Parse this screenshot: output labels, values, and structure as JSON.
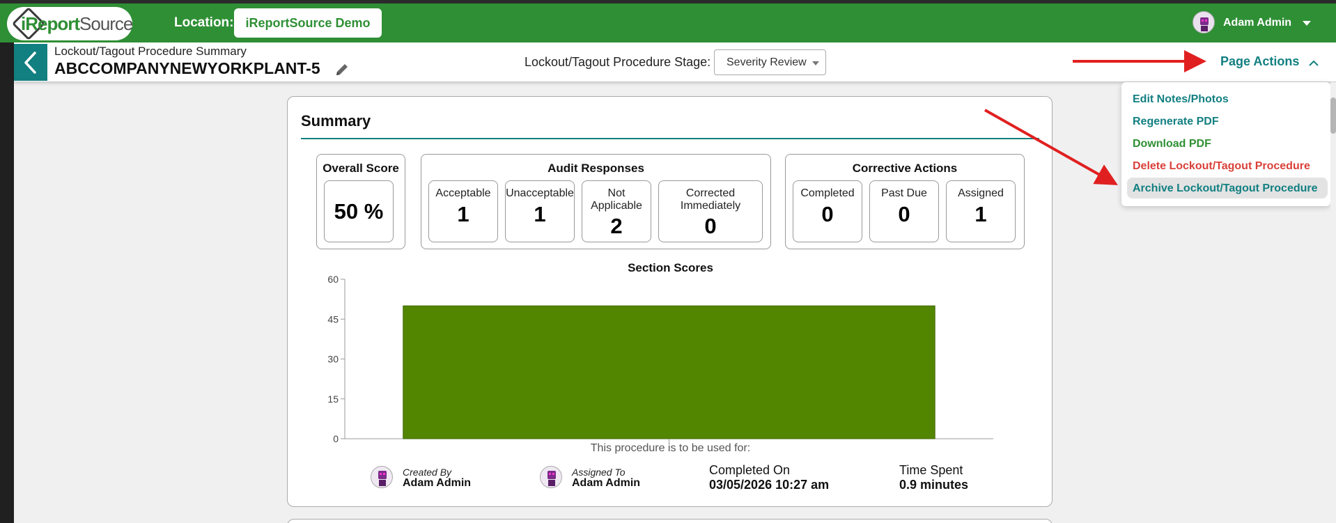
{
  "navbar": {
    "logo_text_i": "i",
    "logo_text_report": "Report",
    "logo_text_source": "Source",
    "location_label": "Location:",
    "location_value": "iReportSource Demo",
    "user_name": "Adam Admin"
  },
  "subheader": {
    "breadcrumb": "Lockout/Tagout Procedure Summary",
    "title": "ABCCOMPANYNEWYORKPLANT-5",
    "stage_label": "Lockout/Tagout Procedure Stage:",
    "stage_value": "Severity Review",
    "page_actions_label": "Page Actions"
  },
  "page_actions_menu": [
    {
      "label": "Edit Notes/Photos",
      "color": "#127f81"
    },
    {
      "label": "Regenerate PDF",
      "color": "#127f81"
    },
    {
      "label": "Download PDF",
      "color": "#2f8f35"
    },
    {
      "label": "Delete Lockout/Tagout Procedure",
      "color": "#d9413a"
    },
    {
      "label": "Archive Lockout/Tagout Procedure",
      "color": "#127f81",
      "highlighted": true
    }
  ],
  "summary": {
    "title": "Summary",
    "overall_score": {
      "title": "Overall Score",
      "value": "50 %"
    },
    "audit_responses": {
      "title": "Audit Responses",
      "items": [
        {
          "label": "Acceptable",
          "value": "1"
        },
        {
          "label": "Unacceptable",
          "value": "1"
        },
        {
          "label_line1": "Not",
          "label_line2": "Applicable",
          "value": "2"
        },
        {
          "label_line1": "Corrected",
          "label_line2": "Immediately",
          "value": "0"
        }
      ]
    },
    "corrective_actions": {
      "title": "Corrective Actions",
      "items": [
        {
          "label": "Completed",
          "value": "0"
        },
        {
          "label": "Past Due",
          "value": "0"
        },
        {
          "label": "Assigned",
          "value": "1"
        }
      ]
    },
    "used_for_text": "This procedure is to be used for:",
    "created_by_label": "Created By",
    "created_by_value": "Adam Admin",
    "assigned_to_label": "Assigned To",
    "assigned_to_value": "Adam Admin",
    "completed_on_label": "Completed On",
    "completed_on_value": "03/05/2026 10:27 am",
    "time_spent_label": "Time Spent",
    "time_spent_value": "0.9 minutes"
  },
  "chart_data": {
    "type": "bar",
    "title": "Section Scores",
    "categories": [
      ""
    ],
    "values": [
      50
    ],
    "ylim": [
      0,
      60
    ],
    "yticks": [
      0,
      15,
      30,
      45,
      60
    ],
    "bar_color": "#538600",
    "xlabel": "",
    "ylabel": ""
  },
  "colors": {
    "brand_green": "#2f8f35",
    "teal": "#127f81",
    "danger": "#d9413a",
    "annotation_arrow": "#e02020"
  }
}
